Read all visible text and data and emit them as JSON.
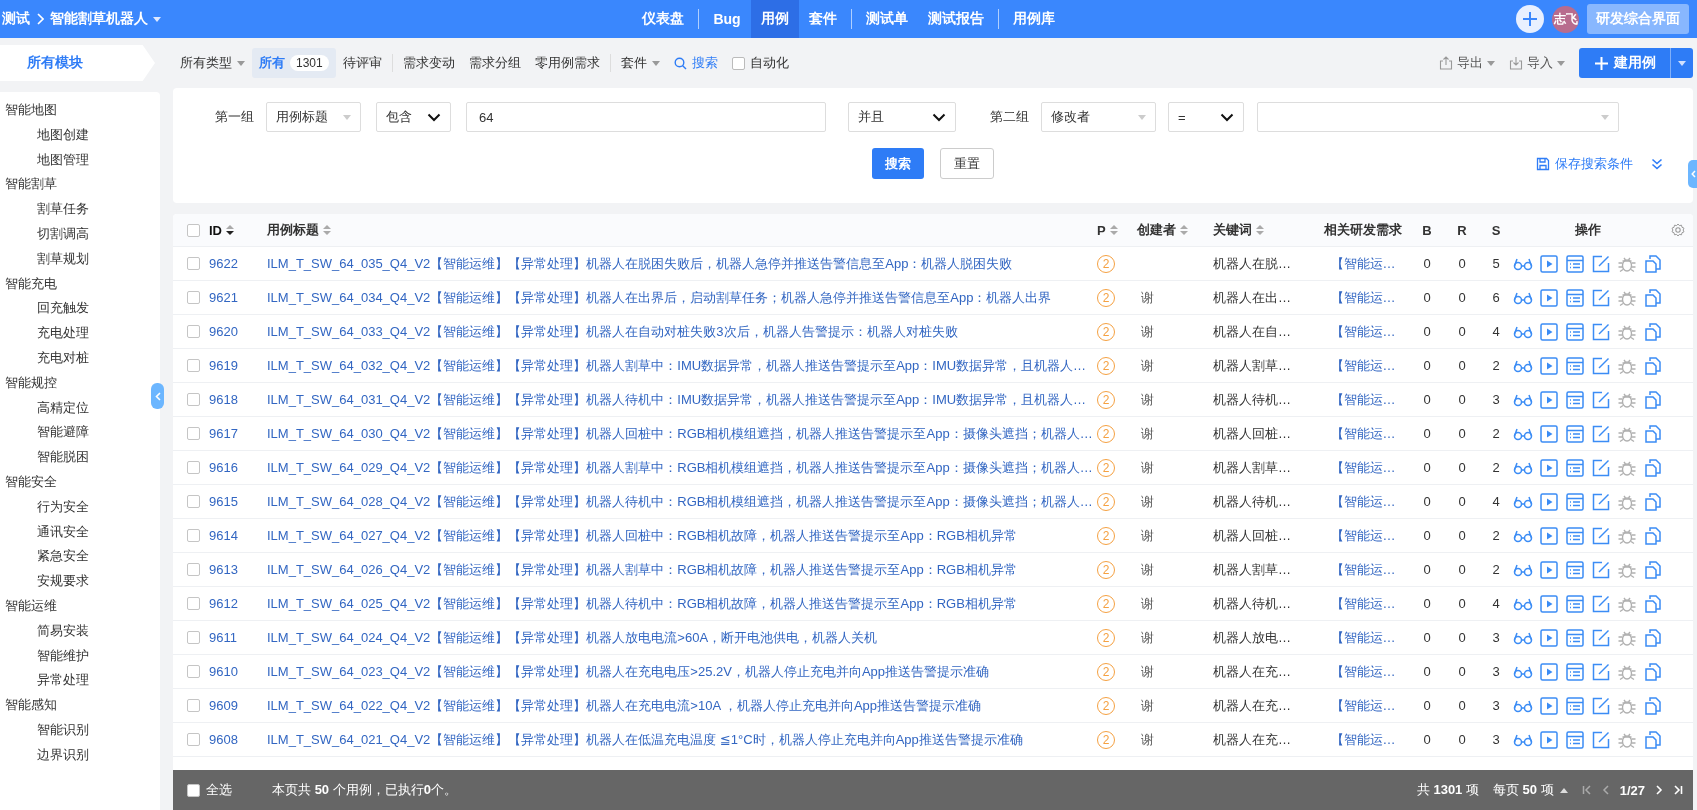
{
  "top_nav": {
    "breadcrumb": [
      {
        "label": "测试",
        "dropdown": false
      },
      {
        "label": "智能割草机器人",
        "dropdown": true
      }
    ],
    "menu_groups": [
      {
        "items": [
          {
            "label": "仪表盘",
            "selected": false
          }
        ]
      },
      {
        "items": [
          {
            "label": "Bug",
            "selected": false
          },
          {
            "label": "用例",
            "selected": true
          },
          {
            "label": "套件",
            "selected": false
          }
        ]
      },
      {
        "items": [
          {
            "label": "测试单",
            "selected": false
          },
          {
            "label": "测试报告",
            "selected": false
          }
        ]
      },
      {
        "items": [
          {
            "label": "用例库",
            "selected": false
          }
        ]
      }
    ],
    "avatar": "志飞",
    "switch_button": "研发综合界面"
  },
  "sidebar": {
    "title": "所有模块",
    "modules": [
      {
        "label": "智能地图",
        "children": [
          {
            "label": "地图创建"
          },
          {
            "label": "地图管理"
          }
        ]
      },
      {
        "label": "智能割草",
        "children": [
          {
            "label": "割草任务"
          },
          {
            "label": "切割调高"
          },
          {
            "label": "割草规划"
          }
        ]
      },
      {
        "label": "智能充电",
        "children": [
          {
            "label": "回充触发"
          },
          {
            "label": "充电处理"
          },
          {
            "label": "充电对桩"
          }
        ]
      },
      {
        "label": "智能规控",
        "children": [
          {
            "label": "高精定位"
          },
          {
            "label": "智能避障"
          },
          {
            "label": "智能脱困"
          }
        ]
      },
      {
        "label": "智能安全",
        "children": [
          {
            "label": "行为安全"
          },
          {
            "label": "通讯安全"
          },
          {
            "label": "紧急安全"
          },
          {
            "label": "安规要求"
          }
        ]
      },
      {
        "label": "智能运维",
        "children": [
          {
            "label": "简易安装"
          },
          {
            "label": "智能维护"
          },
          {
            "label": "异常处理"
          }
        ]
      },
      {
        "label": "智能感知",
        "children": [
          {
            "label": "智能识别"
          },
          {
            "label": "边界识别"
          }
        ]
      }
    ]
  },
  "toolbar": {
    "groups": [
      {
        "items": [
          {
            "kind": "dropdown",
            "label": "所有类型"
          },
          {
            "kind": "tab",
            "label": "所有",
            "count": "1301",
            "selected": true
          },
          {
            "kind": "tab",
            "label": "待评审",
            "selected": false
          }
        ]
      },
      {
        "items": [
          {
            "kind": "tab",
            "label": "需求变动",
            "selected": false
          },
          {
            "kind": "tab",
            "label": "需求分组",
            "selected": false
          },
          {
            "kind": "tab",
            "label": "零用例需求",
            "selected": false
          }
        ]
      },
      {
        "items": [
          {
            "kind": "dropdown",
            "label": "套件"
          },
          {
            "kind": "search",
            "label": "搜索",
            "expanded": true
          },
          {
            "kind": "checkbox",
            "label": "自动化",
            "checked": false
          }
        ]
      }
    ],
    "export": "导出",
    "import": "导入",
    "create": "建用例"
  },
  "filter": {
    "group1": {
      "label": "第一组",
      "field": "用例标题",
      "operator": "包含",
      "value": "64"
    },
    "conjunction": "并且",
    "group2": {
      "label": "第二组",
      "field": "修改者",
      "operator": "="
    },
    "search_button": "搜索",
    "reset_button": "重置",
    "save_link": "保存搜索条件"
  },
  "table": {
    "header_checked": false,
    "columns": [
      {
        "label": "ID",
        "sortable": true,
        "sorted": true
      },
      {
        "label": "用例标题",
        "sortable": true,
        "sorted": false
      },
      {
        "label": "P",
        "sortable": true,
        "sorted": false
      },
      {
        "label": "创建者",
        "sortable": true,
        "sorted": false
      },
      {
        "label": "关键词",
        "sortable": true,
        "sorted": false
      },
      {
        "label": "相关研发需求",
        "sortable": false,
        "sorted": false
      },
      {
        "label": "B",
        "sortable": false,
        "sorted": false
      },
      {
        "label": "R",
        "sortable": false,
        "sorted": false
      },
      {
        "label": "S",
        "sortable": false,
        "sorted": false
      },
      {
        "label": "操作",
        "sortable": false,
        "sorted": false
      }
    ],
    "rows": [
      {
        "checked": false,
        "id": "9622",
        "title": "ILM_T_SW_64_035_Q4_V2【智能运维】【异常处理】机器人在脱困失败后，机器人急停并推送告警信息至App：机器人脱困失败",
        "priority": "2",
        "keyword": "机器人在脱…",
        "requirement": "【智能运…",
        "b": "0",
        "r": "0",
        "s": "5"
      },
      {
        "checked": false,
        "id": "9621",
        "title": "ILM_T_SW_64_034_Q4_V2【智能运维】【异常处理】机器人在出界后，启动割草任务；机器人急停并推送告警信息至App：机器人出界",
        "priority": "2",
        "creator": "谢",
        "keyword": "机器人在出…",
        "requirement": "【智能运…",
        "b": "0",
        "r": "0",
        "s": "6"
      },
      {
        "checked": false,
        "id": "9620",
        "title": "ILM_T_SW_64_033_Q4_V2【智能运维】【异常处理】机器人在自动对桩失败3次后，机器人告警提示：机器人对桩失败",
        "priority": "2",
        "creator": "谢",
        "keyword": "机器人在自…",
        "requirement": "【智能运…",
        "b": "0",
        "r": "0",
        "s": "4"
      },
      {
        "checked": false,
        "id": "9619",
        "title": "ILM_T_SW_64_032_Q4_V2【智能运维】【异常处理】机器人割草中：IMU数据异常，机器人推送告警提示至App：IMU数据异常，且机器人…",
        "priority": "2",
        "creator": "谢",
        "keyword": "机器人割草…",
        "requirement": "【智能运…",
        "b": "0",
        "r": "0",
        "s": "2"
      },
      {
        "checked": false,
        "id": "9618",
        "title": "ILM_T_SW_64_031_Q4_V2【智能运维】【异常处理】机器人待机中：IMU数据异常，机器人推送告警提示至App：IMU数据异常，且机器人…",
        "priority": "2",
        "creator": "谢",
        "keyword": "机器人待机…",
        "requirement": "【智能运…",
        "b": "0",
        "r": "0",
        "s": "3"
      },
      {
        "checked": false,
        "id": "9617",
        "title": "ILM_T_SW_64_030_Q4_V2【智能运维】【异常处理】机器人回桩中：RGB相机模组遮挡，机器人推送告警提示至App：摄像头遮挡；机器人…",
        "priority": "2",
        "creator": "谢",
        "keyword": "机器人回桩…",
        "requirement": "【智能运…",
        "b": "0",
        "r": "0",
        "s": "2"
      },
      {
        "checked": false,
        "id": "9616",
        "title": "ILM_T_SW_64_029_Q4_V2【智能运维】【异常处理】机器人割草中：RGB相机模组遮挡，机器人推送告警提示至App：摄像头遮挡；机器人…",
        "priority": "2",
        "creator": "谢",
        "keyword": "机器人割草…",
        "requirement": "【智能运…",
        "b": "0",
        "r": "0",
        "s": "2"
      },
      {
        "checked": false,
        "id": "9615",
        "title": "ILM_T_SW_64_028_Q4_V2【智能运维】【异常处理】机器人待机中：RGB相机模组遮挡，机器人推送告警提示至App：摄像头遮挡；机器人…",
        "priority": "2",
        "creator": "谢",
        "keyword": "机器人待机…",
        "requirement": "【智能运…",
        "b": "0",
        "r": "0",
        "s": "4"
      },
      {
        "checked": false,
        "id": "9614",
        "title": "ILM_T_SW_64_027_Q4_V2【智能运维】【异常处理】机器人回桩中：RGB相机故障，机器人推送告警提示至App：RGB相机异常",
        "priority": "2",
        "creator": "谢",
        "keyword": "机器人回桩…",
        "requirement": "【智能运…",
        "b": "0",
        "r": "0",
        "s": "2"
      },
      {
        "checked": false,
        "id": "9613",
        "title": "ILM_T_SW_64_026_Q4_V2【智能运维】【异常处理】机器人割草中：RGB相机故障，机器人推送告警提示至App：RGB相机异常",
        "priority": "2",
        "creator": "谢",
        "keyword": "机器人割草…",
        "requirement": "【智能运…",
        "b": "0",
        "r": "0",
        "s": "2"
      },
      {
        "checked": false,
        "id": "9612",
        "title": "ILM_T_SW_64_025_Q4_V2【智能运维】【异常处理】机器人待机中：RGB相机故障，机器人推送告警提示至App：RGB相机异常",
        "priority": "2",
        "creator": "谢",
        "keyword": "机器人待机…",
        "requirement": "【智能运…",
        "b": "0",
        "r": "0",
        "s": "4"
      },
      {
        "checked": false,
        "id": "9611",
        "title": "ILM_T_SW_64_024_Q4_V2【智能运维】【异常处理】机器人放电电流>60A，断开电池供电，机器人关机",
        "priority": "2",
        "creator": "谢",
        "keyword": "机器人放电…",
        "requirement": "【智能运…",
        "b": "0",
        "r": "0",
        "s": "3"
      },
      {
        "checked": false,
        "id": "9610",
        "title": "ILM_T_SW_64_023_Q4_V2【智能运维】【异常处理】机器人在充电电压>25.2V，机器人停止充电并向App推送告警提示准确",
        "priority": "2",
        "creator": "谢",
        "keyword": "机器人在充…",
        "requirement": "【智能运…",
        "b": "0",
        "r": "0",
        "s": "3"
      },
      {
        "checked": false,
        "id": "9609",
        "title": "ILM_T_SW_64_022_Q4_V2【智能运维】【异常处理】机器人在充电电流>10A ，机器人停止充电并向App推送告警提示准确",
        "priority": "2",
        "creator": "谢",
        "keyword": "机器人在充…",
        "requirement": "【智能运…",
        "b": "0",
        "r": "0",
        "s": "3"
      },
      {
        "checked": false,
        "id": "9608",
        "title": "ILM_T_SW_64_021_Q4_V2【智能运维】【异常处理】机器人在低温充电温度 ≦1°C时，机器人停止充电并向App推送告警提示准确",
        "priority": "2",
        "creator": "谢",
        "keyword": "机器人在充…",
        "requirement": "【智能运…",
        "b": "0",
        "r": "0",
        "s": "3"
      }
    ]
  },
  "footer": {
    "select_all": "全选",
    "select_all_checked": false,
    "summary": "本页共 **50** 个用例，已执行**0**个。",
    "total": "共 **1301** 项",
    "per_page": "每页 **50** 项",
    "page": "1/27"
  }
}
